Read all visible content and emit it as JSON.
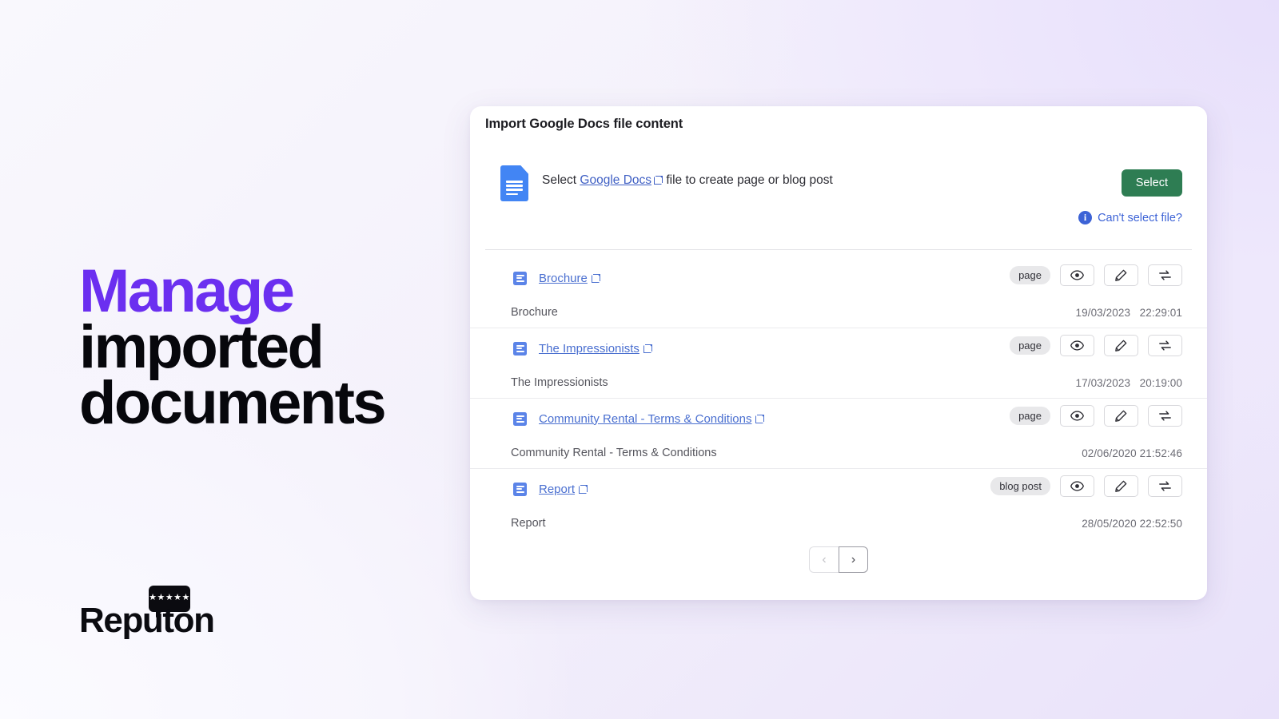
{
  "hero": {
    "headline_accent": "Manage",
    "headline_line2": "imported",
    "headline_line3": "documents",
    "accent_color": "#6b2ff0"
  },
  "brand": {
    "name": "Reputon",
    "stars": "★★★★★"
  },
  "card": {
    "title": "Import Google Docs file content",
    "select_prompt_before": "Select",
    "select_link": "Google Docs",
    "select_prompt_after": "file to create page or blog post",
    "select_button": "Select",
    "cant_select_label": "Can't select file?",
    "info_glyph": "i",
    "accent_green": "#2e7d53",
    "link_blue": "#4a6fd0"
  },
  "documents": [
    {
      "link_title": "Brochure",
      "name": "Brochure",
      "type_badge": "page",
      "date": "19/03/2023",
      "time": "22:29:01"
    },
    {
      "link_title": "The Impressionists",
      "name": "The Impressionists",
      "type_badge": "page",
      "date": "17/03/2023",
      "time": "20:19:00"
    },
    {
      "link_title": "Community Rental - Terms & Conditions",
      "name": "Community Rental - Terms & Conditions",
      "type_badge": "page",
      "date": "02/06/2020",
      "time": "21:52:46"
    },
    {
      "link_title": "Report",
      "name": "Report",
      "type_badge": "blog post",
      "date": "28/05/2020",
      "time": "22:52:50"
    }
  ],
  "actions": {
    "view_icon": "eye-icon",
    "edit_icon": "pencil-icon",
    "sync_icon": "sync-icon"
  },
  "pagination": {
    "prev_glyph": "‹",
    "next_glyph": "›"
  }
}
